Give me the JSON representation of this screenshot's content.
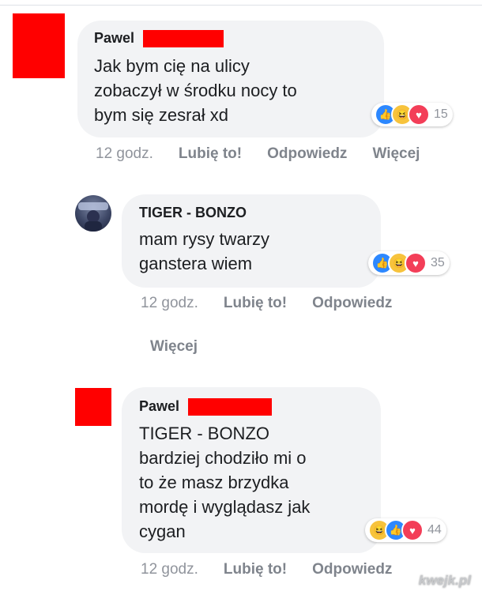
{
  "comments": [
    {
      "author": "Pawel",
      "lines": [
        "Jak bym cię na ulicy",
        "zobaczył w środku nocy to",
        "bym się zesrał xd"
      ],
      "reaction_icons": [
        "like-icon",
        "haha-icon",
        "love-icon"
      ],
      "reaction_count": "15",
      "time": "12 godz.",
      "like_label": "Lubię to!",
      "reply_label": "Odpowiedz",
      "more_label": "Więcej"
    },
    {
      "author": "TIGER - BONZO",
      "lines": [
        "mam rysy twarzy",
        "ganstera wiem"
      ],
      "reaction_icons": [
        "like-icon",
        "haha-icon",
        "love-icon"
      ],
      "reaction_count": "35",
      "time": "12 godz.",
      "like_label": "Lubię to!",
      "reply_label": "Odpowiedz",
      "more_label": "Więcej"
    },
    {
      "author": "Pawel",
      "lines": [
        "TIGER - BONZO",
        "bardziej chodziło mi o",
        "to że masz brzydka",
        "mordę i wyglądasz jak",
        "cygan"
      ],
      "reaction_icons": [
        "haha-icon",
        "like-icon",
        "love-icon"
      ],
      "reaction_count": "44",
      "time": "12 godz.",
      "like_label": "Lubię to!",
      "reply_label": "Odpowiedz"
    }
  ],
  "watermark": "kwejk.pl",
  "colors": {
    "redaction": "#ff0000",
    "like": "#2d88ff",
    "love": "#f33e58",
    "haha": "#f7c33c",
    "bubble": "#f2f3f5"
  }
}
